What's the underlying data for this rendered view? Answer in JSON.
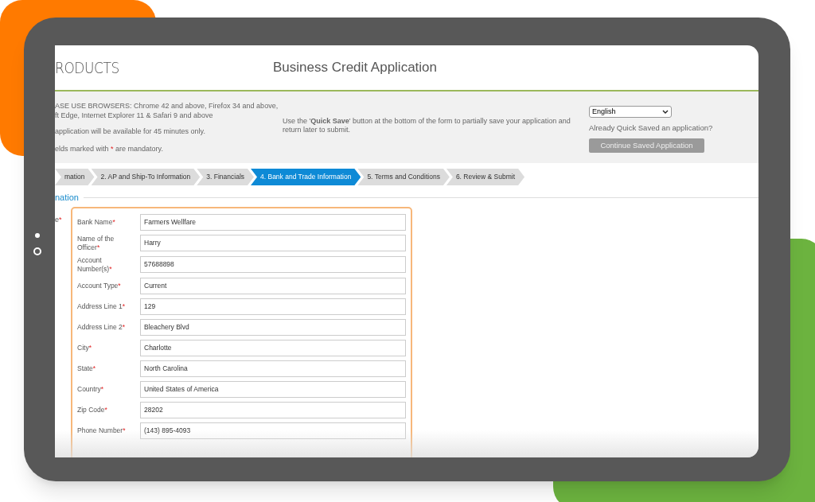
{
  "header": {
    "logo": "RODUCTS",
    "title": "Business Credit Application"
  },
  "notices": {
    "browsers": [
      "ASE USE BROWSERS: Chrome 42 and above, Firefox 34 and above,",
      "ft Edge, Internet Explorer 11 & Safari 9 and above"
    ],
    "timeout": "application will be available for 45 minutes only.",
    "mandatory": {
      "before": "elds marked with ",
      "mark": "*",
      "after": " are mandatory."
    },
    "quick_save": "Use the '**Quick Save**' button at the bottom of the form to partially save your application and return later to submit."
  },
  "language": {
    "value": "English"
  },
  "saved": {
    "question": "Already Quick Saved an application?",
    "button": "Continue Saved Application",
    "disabled": true
  },
  "steps": [
    {
      "label": "mation",
      "selected": false
    },
    {
      "label": "2. AP and Ship-To Information",
      "selected": false
    },
    {
      "label": "3. Financials",
      "selected": false
    },
    {
      "label": "4. Bank and Trade Information",
      "selected": true
    },
    {
      "label": "5. Terms and Conditions",
      "selected": false
    },
    {
      "label": "6. Review & Submit",
      "selected": false
    }
  ],
  "section": {
    "title": "nation",
    "side_label": "e",
    "side_required": true
  },
  "fields": [
    {
      "label": "Bank Name",
      "required": true,
      "value": "Farmers Wellfare"
    },
    {
      "label": "Name of the Officer",
      "required": true,
      "value": "Harry"
    },
    {
      "label": "Account Number(s)",
      "required": true,
      "value": "57688898"
    },
    {
      "label": "Account Type",
      "required": true,
      "value": "Current"
    },
    {
      "label": "Address Line 1",
      "required": true,
      "value": "129"
    },
    {
      "label": "Address Line 2",
      "required": true,
      "value": "Bleachery Blvd"
    },
    {
      "label": "City",
      "required": true,
      "value": "Charlotte"
    },
    {
      "label": "State",
      "required": true,
      "value": "North Carolina"
    },
    {
      "label": "Country",
      "required": true,
      "value": "United States of America"
    },
    {
      "label": "Zip Code",
      "required": true,
      "value": "28202"
    },
    {
      "label": "Phone Number",
      "required": true,
      "value": "(143) 895-4093"
    }
  ]
}
